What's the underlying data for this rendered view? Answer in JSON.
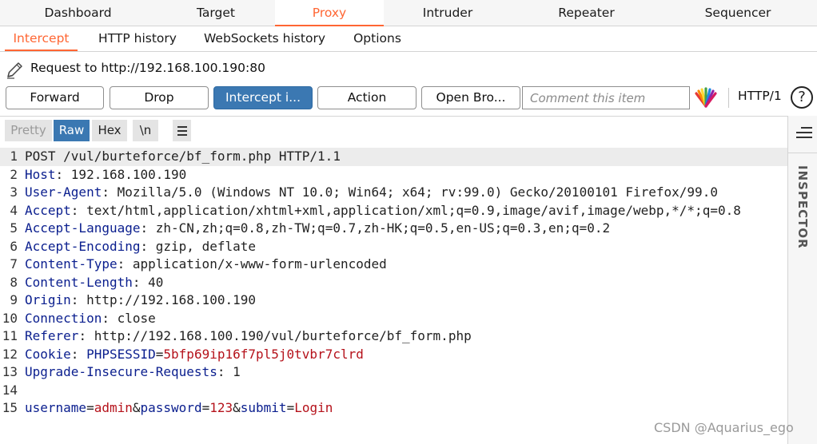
{
  "main_tabs": [
    "Dashboard",
    "Target",
    "Proxy",
    "Intruder",
    "Repeater",
    "Sequencer"
  ],
  "sub_tabs": [
    "Intercept",
    "HTTP history",
    "WebSockets history",
    "Options"
  ],
  "request_line": "Request to http://192.168.100.190:80",
  "toolbar": {
    "forward": "Forward",
    "drop": "Drop",
    "intercept": "Intercept i...",
    "action": "Action",
    "open_browser": "Open Bro...",
    "comment_placeholder": "Comment this item",
    "http_version": "HTTP/1",
    "help": "?"
  },
  "view_tabs": [
    "Pretty",
    "Raw",
    "Hex",
    "\\n"
  ],
  "inspector_label": "INSPECTOR",
  "lines": [
    {
      "n": "1",
      "segs": [
        {
          "t": "POST /vul/burteforce/bf_form.php HTTP/1.1",
          "c": "plain"
        }
      ]
    },
    {
      "n": "2",
      "segs": [
        {
          "t": "Host",
          "c": "hdr"
        },
        {
          "t": ": 192.168.100.190",
          "c": "plain"
        }
      ]
    },
    {
      "n": "3",
      "segs": [
        {
          "t": "User-Agent",
          "c": "hdr"
        },
        {
          "t": ": Mozilla/5.0 (Windows NT 10.0; Win64; x64; rv:99.0) Gecko/20100101 Firefox/99.0",
          "c": "plain"
        }
      ]
    },
    {
      "n": "4",
      "segs": [
        {
          "t": "Accept",
          "c": "hdr"
        },
        {
          "t": ": text/html,application/xhtml+xml,application/xml;q=0.9,image/avif,image/webp,*/*;q=0.8",
          "c": "plain"
        }
      ]
    },
    {
      "n": "5",
      "segs": [
        {
          "t": "Accept-Language",
          "c": "hdr"
        },
        {
          "t": ": zh-CN,zh;q=0.8,zh-TW;q=0.7,zh-HK;q=0.5,en-US;q=0.3,en;q=0.2",
          "c": "plain"
        }
      ]
    },
    {
      "n": "6",
      "segs": [
        {
          "t": "Accept-Encoding",
          "c": "hdr"
        },
        {
          "t": ": gzip, deflate",
          "c": "plain"
        }
      ]
    },
    {
      "n": "7",
      "segs": [
        {
          "t": "Content-Type",
          "c": "hdr"
        },
        {
          "t": ": application/x-www-form-urlencoded",
          "c": "plain"
        }
      ]
    },
    {
      "n": "8",
      "segs": [
        {
          "t": "Content-Length",
          "c": "hdr"
        },
        {
          "t": ": 40",
          "c": "plain"
        }
      ]
    },
    {
      "n": "9",
      "segs": [
        {
          "t": "Origin",
          "c": "hdr"
        },
        {
          "t": ": http://192.168.100.190",
          "c": "plain"
        }
      ]
    },
    {
      "n": "10",
      "segs": [
        {
          "t": "Connection",
          "c": "hdr"
        },
        {
          "t": ": close",
          "c": "plain"
        }
      ]
    },
    {
      "n": "11",
      "segs": [
        {
          "t": "Referer",
          "c": "hdr"
        },
        {
          "t": ": http://192.168.100.190/vul/burteforce/bf_form.php",
          "c": "plain"
        }
      ]
    },
    {
      "n": "12",
      "segs": [
        {
          "t": "Cookie",
          "c": "hdr"
        },
        {
          "t": ": ",
          "c": "plain"
        },
        {
          "t": "PHPSESSID",
          "c": "blue"
        },
        {
          "t": "=",
          "c": "plain"
        },
        {
          "t": "5bfp69ip16f7pl5j0tvbr7clrd",
          "c": "red"
        }
      ]
    },
    {
      "n": "13",
      "segs": [
        {
          "t": "Upgrade-Insecure-Requests",
          "c": "hdr"
        },
        {
          "t": ": 1",
          "c": "plain"
        }
      ]
    },
    {
      "n": "14",
      "segs": []
    },
    {
      "n": "15",
      "segs": [
        {
          "t": "username",
          "c": "blue"
        },
        {
          "t": "=",
          "c": "plain"
        },
        {
          "t": "admin",
          "c": "red"
        },
        {
          "t": "&",
          "c": "plain"
        },
        {
          "t": "password",
          "c": "blue"
        },
        {
          "t": "=",
          "c": "plain"
        },
        {
          "t": "123",
          "c": "red"
        },
        {
          "t": "&",
          "c": "plain"
        },
        {
          "t": "submit",
          "c": "blue"
        },
        {
          "t": "=",
          "c": "plain"
        },
        {
          "t": "Login",
          "c": "red"
        }
      ]
    }
  ],
  "watermark": "CSDN @Aquarius_ego",
  "colors": {
    "accent": "#ff6633",
    "primary_button": "#3b78b2",
    "header_name": "#0a1e8e",
    "param_value": "#b5121b"
  }
}
